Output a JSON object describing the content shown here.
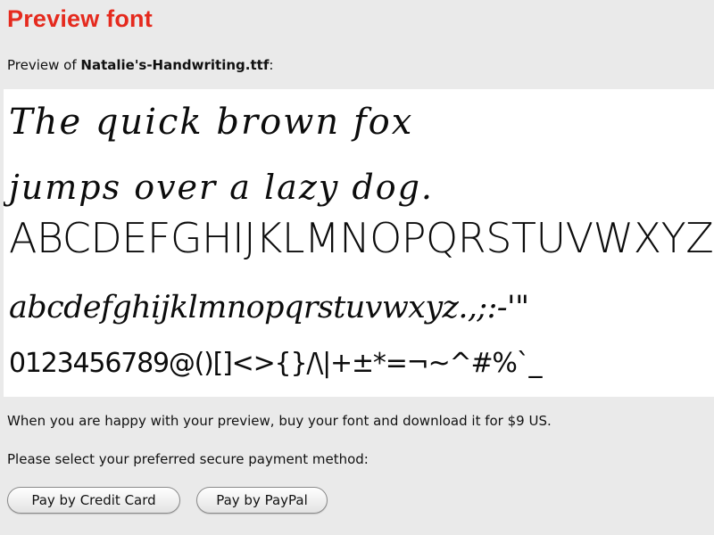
{
  "header": {
    "title": "Preview font"
  },
  "preview": {
    "prefix": "Preview of ",
    "filename": "Natalie's-Handwriting.ttf",
    "suffix": ":",
    "lines": [
      "The quick brown fox",
      "jumps over a lazy dog.",
      "ABCDEFGHIJKLMNOPQRSTUVWXYZ&",
      "abcdefghijklmnopqrstuvwxyz.,;:-'\"",
      "0123456789@()[]<>{}/\\|+±*=¬~^#%`_"
    ]
  },
  "info": {
    "buy_text": "When you are happy with your preview, buy your font and download it for $9 US.",
    "select_text": "Please select your preferred secure payment method:"
  },
  "buttons": {
    "credit_card": "Pay by Credit Card",
    "paypal": "Pay by PayPal"
  },
  "colors": {
    "title": "#e52a1e",
    "background": "#eaeaea",
    "preview_bg": "#ffffff"
  }
}
